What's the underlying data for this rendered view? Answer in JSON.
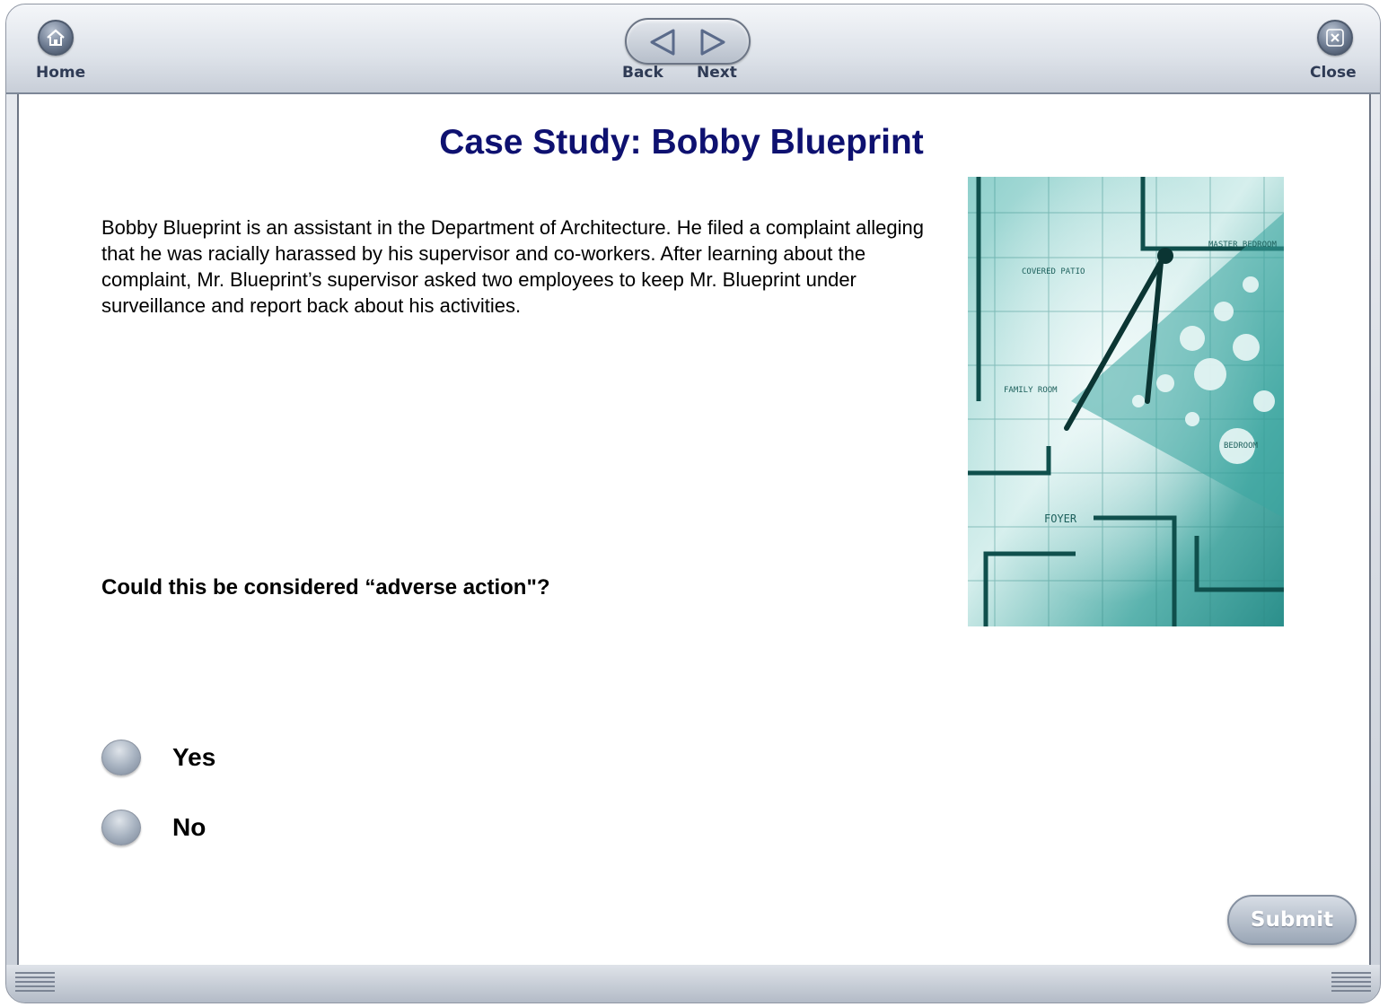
{
  "toolbar": {
    "home_label": "Home",
    "back_label": "Back",
    "next_label": "Next",
    "close_label": "Close"
  },
  "main": {
    "title": "Case Study: Bobby Blueprint",
    "paragraph": "Bobby Blueprint is an assistant in the Department of Architecture. He filed a complaint alleging that he was racially harassed by his supervisor and co-workers. After learning about the complaint, Mr. Blueprint’s supervisor asked two employees to keep Mr. Blueprint under surveillance and report back about his activities.",
    "question": "Could this be considered “adverse action\"?",
    "options": [
      {
        "label": "Yes"
      },
      {
        "label": "No"
      }
    ],
    "submit_label": "Submit"
  },
  "figure": {
    "labels": [
      "COVERED PATIO",
      "MASTER BEDROOM",
      "FAMILY ROOM",
      "FOYER",
      "BEDROOM"
    ]
  },
  "colors": {
    "title": "#0e1170",
    "blueprint_teal": "#2b9a97",
    "frame": "#c9cfd8"
  }
}
